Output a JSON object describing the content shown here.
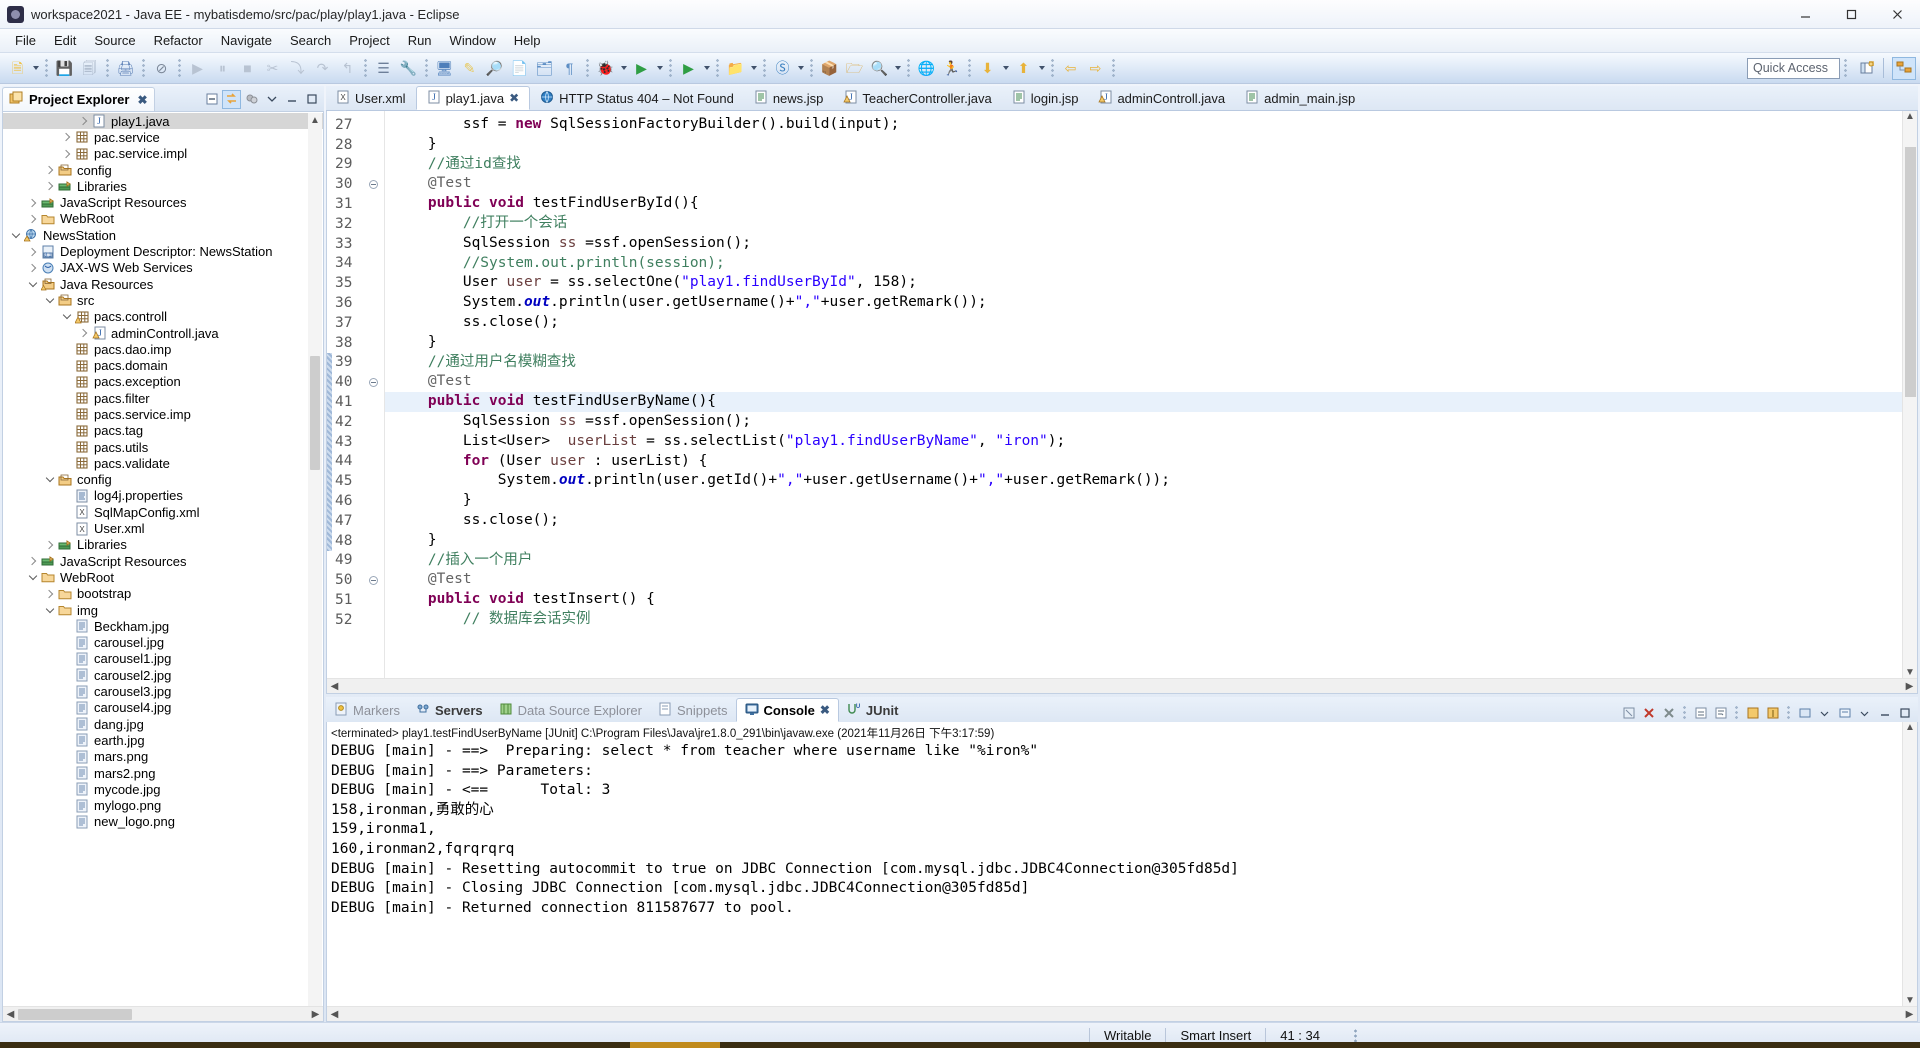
{
  "window": {
    "title": "workspace2021 - Java EE - mybatisdemo/src/pac/play/play1.java - Eclipse",
    "app_icon": "eclipse-icon",
    "minimize": "–",
    "maximize": "□",
    "close": "✕"
  },
  "menubar": {
    "items": [
      "File",
      "Edit",
      "Source",
      "Refactor",
      "Navigate",
      "Search",
      "Project",
      "Run",
      "Window",
      "Help"
    ]
  },
  "toolbar": {
    "quick_access_label": "Quick Access",
    "groups": [
      {
        "name": "new",
        "icons": [
          {
            "n": "new-wizard-icon",
            "g": "🗎",
            "c": "#f0c040"
          },
          {
            "n": "dropdown-arrow",
            "g": "",
            "c": ""
          }
        ]
      },
      {
        "name": "save",
        "icons": [
          {
            "n": "save-icon",
            "g": "💾",
            "c": "#9aa8bb"
          },
          {
            "n": "save-all-icon",
            "g": "🗐",
            "c": "#9aa8bb"
          }
        ]
      },
      {
        "name": "print",
        "icons": [
          {
            "n": "print-icon",
            "g": "🖨",
            "c": "#5b7fb5"
          }
        ]
      },
      {
        "name": "remove-markers",
        "icons": [
          {
            "n": "remove-markers-icon",
            "g": "⊘",
            "c": "#7b8798"
          }
        ]
      },
      {
        "name": "debug-run",
        "icons": [
          {
            "n": "resume-icon",
            "g": "▶",
            "c": "#b8c3d2"
          },
          {
            "n": "suspend-icon",
            "g": "⏸",
            "c": "#b8c3d2"
          },
          {
            "n": "terminate-icon",
            "g": "■",
            "c": "#b8c3d2"
          },
          {
            "n": "disconnect-icon",
            "g": "✂",
            "c": "#b8c3d2"
          },
          {
            "n": "step-into-icon",
            "g": "⤵",
            "c": "#b8c3d2"
          },
          {
            "n": "step-over-icon",
            "g": "↷",
            "c": "#b8c3d2"
          },
          {
            "n": "step-return-icon",
            "g": "↰",
            "c": "#b8c3d2"
          }
        ]
      },
      {
        "name": "build",
        "icons": [
          {
            "n": "build-icon",
            "g": "☰",
            "c": "#6d7f99"
          },
          {
            "n": "run-ant-icon",
            "g": "🔧",
            "c": "#e8b33a"
          }
        ]
      },
      {
        "name": "server",
        "icons": [
          {
            "n": "new-server-icon",
            "g": "🖥",
            "c": "#4f7fba"
          },
          {
            "n": "open-editor-icon",
            "g": "✎",
            "c": "#e8c85a"
          },
          {
            "n": "toggle-mark-icon",
            "g": "🔎",
            "c": "#8a99ad"
          },
          {
            "n": "new-jsp-icon",
            "g": "📄",
            "c": "#5d8ec4"
          },
          {
            "n": "new-xml-icon",
            "g": "🗂",
            "c": "#5d8ec4"
          },
          {
            "n": "new-html-icon",
            "g": "¶",
            "c": "#5d8ec4"
          }
        ]
      },
      {
        "name": "debug-launch",
        "icons": [
          {
            "n": "debug-icon",
            "g": "🐞",
            "c": "#3a7fbf"
          },
          {
            "n": "dropdown-arrow",
            "g": "",
            "c": ""
          },
          {
            "n": "run-icon",
            "g": "▶",
            "c": "#2f9e44"
          },
          {
            "n": "dropdown-arrow",
            "g": "",
            "c": ""
          }
        ]
      },
      {
        "name": "coverage",
        "icons": [
          {
            "n": "coverage-icon",
            "g": "▶",
            "c": "#2f9e44"
          },
          {
            "n": "dropdown-arrow",
            "g": "",
            "c": ""
          }
        ]
      },
      {
        "name": "profile",
        "icons": [
          {
            "n": "new-java-project-icon",
            "g": "📁",
            "c": "#d9a33a"
          },
          {
            "n": "dropdown-arrow",
            "g": "",
            "c": ""
          }
        ]
      },
      {
        "name": "skip",
        "icons": [
          {
            "n": "skip-breakpoints-icon",
            "g": "Ⓢ",
            "c": "#3a7fbf"
          },
          {
            "n": "dropdown-arrow",
            "g": "",
            "c": ""
          }
        ]
      },
      {
        "name": "packages",
        "icons": [
          {
            "n": "new-package-icon",
            "g": "📦",
            "c": "#d9a33a"
          },
          {
            "n": "open-type-icon",
            "g": "🗁",
            "c": "#d9a33a"
          },
          {
            "n": "search-icon",
            "g": "🔍",
            "c": "#d9a33a"
          },
          {
            "n": "dropdown-arrow",
            "g": "",
            "c": ""
          }
        ]
      },
      {
        "name": "web",
        "icons": [
          {
            "n": "open-browser-icon",
            "g": "🌐",
            "c": "#2f7fc4"
          },
          {
            "n": "run-on-server-icon",
            "g": "🏃",
            "c": "#4f8fd0"
          }
        ]
      },
      {
        "name": "navigate",
        "icons": [
          {
            "n": "next-annotation-icon",
            "g": "⬇",
            "c": "#e8b33a"
          },
          {
            "n": "dropdown-arrow",
            "g": "",
            "c": ""
          },
          {
            "n": "previous-annotation-icon",
            "g": "⬆",
            "c": "#e8b33a"
          },
          {
            "n": "dropdown-arrow",
            "g": "",
            "c": ""
          }
        ]
      },
      {
        "name": "history",
        "icons": [
          {
            "n": "back-icon",
            "g": "⇦",
            "c": "#e8b33a"
          },
          {
            "n": "forward-icon",
            "g": "⇨",
            "c": "#e8b33a"
          }
        ]
      }
    ],
    "perspective_buttons": [
      {
        "name": "open-perspective-button",
        "icon": "new-perspective-icon"
      },
      {
        "name": "java-ee-perspective-button",
        "icon": "java-ee-perspective-icon",
        "active": true
      }
    ]
  },
  "explorer": {
    "tab_label": "Project Explorer",
    "tab_icon": "project-explorer-icon",
    "close_icon": "✖",
    "toolbar": [
      {
        "name": "collapse-all-button",
        "icon": "collapse-all-icon"
      },
      {
        "name": "link-with-editor-button",
        "icon": "link-editor-icon",
        "active": true
      },
      {
        "name": "focus-on-active-task-button",
        "icon": "focus-task-icon"
      },
      {
        "name": "view-menu-button",
        "icon": "chevron-down-icon"
      },
      {
        "name": "minimize-view-button",
        "icon": "minimize-icon"
      },
      {
        "name": "maximize-view-button",
        "icon": "maximize-icon"
      }
    ],
    "tree": [
      {
        "label": "play1.java",
        "indent": 4,
        "twist": "closed",
        "icon": "java-file-icon",
        "selected": true
      },
      {
        "label": "pac.service",
        "indent": 3,
        "twist": "closed",
        "icon": "package-icon"
      },
      {
        "label": "pac.service.impl",
        "indent": 3,
        "twist": "closed",
        "icon": "package-icon"
      },
      {
        "label": "config",
        "indent": 2,
        "twist": "closed",
        "icon": "source-folder-icon"
      },
      {
        "label": "Libraries",
        "indent": 2,
        "twist": "closed",
        "icon": "library-icon"
      },
      {
        "label": "JavaScript Resources",
        "indent": 1,
        "twist": "closed",
        "icon": "library-icon"
      },
      {
        "label": "WebRoot",
        "indent": 1,
        "twist": "closed",
        "icon": "folder-icon"
      },
      {
        "label": "NewsStation",
        "indent": 0,
        "twist": "open",
        "icon": "web-project-icon"
      },
      {
        "label": "Deployment Descriptor: NewsStation",
        "indent": 1,
        "twist": "closed",
        "icon": "deployment-descriptor-icon"
      },
      {
        "label": "JAX-WS Web Services",
        "indent": 1,
        "twist": "closed",
        "icon": "jaxws-icon"
      },
      {
        "label": "Java Resources",
        "indent": 1,
        "twist": "open",
        "icon": "java-resources-icon"
      },
      {
        "label": "src",
        "indent": 2,
        "twist": "open",
        "icon": "source-folder-icon"
      },
      {
        "label": "pacs.controll",
        "indent": 3,
        "twist": "open",
        "icon": "package-warning-icon"
      },
      {
        "label": "adminControll.java",
        "indent": 4,
        "twist": "closed",
        "icon": "java-warning-icon"
      },
      {
        "label": "pacs.dao.imp",
        "indent": 3,
        "twist": "none",
        "icon": "package-icon"
      },
      {
        "label": "pacs.domain",
        "indent": 3,
        "twist": "none",
        "icon": "package-icon"
      },
      {
        "label": "pacs.exception",
        "indent": 3,
        "twist": "none",
        "icon": "package-icon"
      },
      {
        "label": "pacs.filter",
        "indent": 3,
        "twist": "none",
        "icon": "package-icon"
      },
      {
        "label": "pacs.service.imp",
        "indent": 3,
        "twist": "none",
        "icon": "package-icon"
      },
      {
        "label": "pacs.tag",
        "indent": 3,
        "twist": "none",
        "icon": "package-icon"
      },
      {
        "label": "pacs.utils",
        "indent": 3,
        "twist": "none",
        "icon": "package-icon"
      },
      {
        "label": "pacs.validate",
        "indent": 3,
        "twist": "none",
        "icon": "package-icon"
      },
      {
        "label": "config",
        "indent": 2,
        "twist": "open",
        "icon": "source-folder-icon"
      },
      {
        "label": "log4j.properties",
        "indent": 3,
        "twist": "none",
        "icon": "properties-file-icon"
      },
      {
        "label": "SqlMapConfig.xml",
        "indent": 3,
        "twist": "none",
        "icon": "xml-file-icon"
      },
      {
        "label": "User.xml",
        "indent": 3,
        "twist": "none",
        "icon": "xml-file-icon"
      },
      {
        "label": "Libraries",
        "indent": 2,
        "twist": "closed",
        "icon": "library-icon"
      },
      {
        "label": "JavaScript Resources",
        "indent": 1,
        "twist": "closed",
        "icon": "library-icon"
      },
      {
        "label": "WebRoot",
        "indent": 1,
        "twist": "open",
        "icon": "folder-icon"
      },
      {
        "label": "bootstrap",
        "indent": 2,
        "twist": "closed",
        "icon": "folder-icon"
      },
      {
        "label": "img",
        "indent": 2,
        "twist": "open",
        "icon": "folder-icon"
      },
      {
        "label": "Beckham.jpg",
        "indent": 3,
        "twist": "none",
        "icon": "file-icon"
      },
      {
        "label": "carousel.jpg",
        "indent": 3,
        "twist": "none",
        "icon": "file-icon"
      },
      {
        "label": "carousel1.jpg",
        "indent": 3,
        "twist": "none",
        "icon": "file-icon"
      },
      {
        "label": "carousel2.jpg",
        "indent": 3,
        "twist": "none",
        "icon": "file-icon"
      },
      {
        "label": "carousel3.jpg",
        "indent": 3,
        "twist": "none",
        "icon": "file-icon"
      },
      {
        "label": "carousel4.jpg",
        "indent": 3,
        "twist": "none",
        "icon": "file-icon"
      },
      {
        "label": "dang.jpg",
        "indent": 3,
        "twist": "none",
        "icon": "file-icon"
      },
      {
        "label": "earth.jpg",
        "indent": 3,
        "twist": "none",
        "icon": "file-icon"
      },
      {
        "label": "mars.png",
        "indent": 3,
        "twist": "none",
        "icon": "file-icon"
      },
      {
        "label": "mars2.png",
        "indent": 3,
        "twist": "none",
        "icon": "file-icon"
      },
      {
        "label": "mycode.jpg",
        "indent": 3,
        "twist": "none",
        "icon": "file-icon"
      },
      {
        "label": "mylogo.png",
        "indent": 3,
        "twist": "none",
        "icon": "file-icon"
      },
      {
        "label": "new_logo.png",
        "indent": 3,
        "twist": "none",
        "icon": "file-icon"
      }
    ]
  },
  "editor": {
    "tabs": [
      {
        "label": "User.xml",
        "icon": "xml-file-icon",
        "active": false
      },
      {
        "label": "play1.java",
        "icon": "java-file-icon",
        "active": true,
        "closeable": true
      },
      {
        "label": "HTTP Status 404 – Not Found",
        "icon": "browser-icon",
        "active": false
      },
      {
        "label": "news.jsp",
        "icon": "jsp-file-icon",
        "active": false
      },
      {
        "label": "TeacherController.java",
        "icon": "java-warning-icon",
        "active": false
      },
      {
        "label": "login.jsp",
        "icon": "jsp-file-icon",
        "active": false
      },
      {
        "label": "adminControll.java",
        "icon": "java-warning-icon",
        "active": false
      },
      {
        "label": "admin_main.jsp",
        "icon": "jsp-file-icon",
        "active": false
      }
    ],
    "first_line": 27,
    "lines": [
      {
        "n": 27,
        "html": "        ssf = <span class=\"kw\">new</span> SqlSessionFactoryBuilder().build(input);"
      },
      {
        "n": 28,
        "html": "    }"
      },
      {
        "n": 29,
        "html": "    <span class=\"cm\">//通过id查找</span>"
      },
      {
        "n": 30,
        "html": "    <span class=\"an\">@Test</span>",
        "fold": true
      },
      {
        "n": 31,
        "html": "    <span class=\"kw\">public</span> <span class=\"kw\">void</span> testFindUserById(){"
      },
      {
        "n": 32,
        "html": "        <span class=\"cm\">//打开一个会话</span>"
      },
      {
        "n": 33,
        "html": "        SqlSession <span class=\"lv\">ss</span> =ssf.openSession();"
      },
      {
        "n": 34,
        "html": "        <span class=\"cm\">//System.out.println(session);</span>"
      },
      {
        "n": 35,
        "html": "        User <span class=\"lv\">user</span> = ss.selectOne(<span class=\"st\">\"play1.findUserById\"</span>, 158);"
      },
      {
        "n": 36,
        "html": "        System.<span class=\"fld\">out</span>.println(user.getUsername()+<span class=\"st\">\",\"</span>+user.getRemark());"
      },
      {
        "n": 37,
        "html": "        ss.close();"
      },
      {
        "n": 38,
        "html": "    }"
      },
      {
        "n": 39,
        "html": "    <span class=\"cm\">//通过用户名模糊查找</span>",
        "change": true
      },
      {
        "n": 40,
        "html": "    <span class=\"an\">@Test</span>",
        "fold": true,
        "change": true
      },
      {
        "n": 41,
        "html": "    <span class=\"kw\">public</span> <span class=\"kw\">void</span> testFindUserByName(){",
        "highlight": true,
        "change": true
      },
      {
        "n": 42,
        "html": "        SqlSession <span class=\"lv\">ss</span> =ssf.openSession();",
        "change": true
      },
      {
        "n": 43,
        "html": "        List&lt;User&gt;  <span class=\"lv\">userList</span> = ss.selectList(<span class=\"st\">\"play1.findUserByName\"</span>, <span class=\"st\">\"iron\"</span>);",
        "change": true
      },
      {
        "n": 44,
        "html": "        <span class=\"kw\">for</span> (User <span class=\"lv\">user</span> : userList) {",
        "change": true
      },
      {
        "n": 45,
        "html": "            System.<span class=\"fld\">out</span>.println(user.getId()+<span class=\"st\">\",\"</span>+user.getUsername()+<span class=\"st\">\",\"</span>+user.getRemark());",
        "change": true
      },
      {
        "n": 46,
        "html": "        }",
        "change": true
      },
      {
        "n": 47,
        "html": "        ss.close();",
        "change": true
      },
      {
        "n": 48,
        "html": "    }",
        "change": true
      },
      {
        "n": 49,
        "html": "    <span class=\"cm\">//插入一个用户</span>"
      },
      {
        "n": 50,
        "html": "    <span class=\"an\">@Test</span>",
        "fold": true
      },
      {
        "n": 51,
        "html": "    <span class=\"kw\">public</span> <span class=\"kw\">void</span> testInsert() {"
      },
      {
        "n": 52,
        "html": "        <span class=\"cm\">// 数据库会话实例</span>"
      }
    ]
  },
  "console": {
    "tabs": [
      {
        "label": "Markers",
        "icon": "markers-icon",
        "active": false,
        "bold": false
      },
      {
        "label": "Servers",
        "icon": "servers-icon",
        "active": false,
        "bold": true
      },
      {
        "label": "Data Source Explorer",
        "icon": "data-source-icon",
        "active": false,
        "bold": false
      },
      {
        "label": "Snippets",
        "icon": "snippets-icon",
        "active": false,
        "bold": false
      },
      {
        "label": "Console",
        "icon": "console-icon",
        "active": true,
        "bold": true,
        "closeable": true
      },
      {
        "label": "JUnit",
        "icon": "junit-icon",
        "active": false,
        "bold": true
      }
    ],
    "toolbar": [
      {
        "name": "clear-console-button",
        "icon": "clear-console-icon"
      },
      {
        "name": "terminate-button",
        "icon": "terminate-icon"
      },
      {
        "name": "remove-launch-button",
        "icon": "remove-launch-icon"
      },
      {
        "name": "remove-all-terminated-button",
        "icon": "remove-all-icon"
      },
      {
        "name": "scroll-lock-button",
        "icon": "scroll-lock-icon"
      },
      {
        "name": "word-wrap-button",
        "icon": "word-wrap-icon"
      },
      {
        "name": "show-console-on-output-button",
        "icon": "show-console-icon"
      },
      {
        "name": "pin-console-button",
        "icon": "pin-icon"
      },
      {
        "name": "open-console-button",
        "icon": "open-console-icon"
      },
      {
        "name": "display-selected-console-button",
        "icon": "display-console-icon"
      },
      {
        "name": "view-menu-button",
        "icon": "chevron-down-icon"
      },
      {
        "name": "minimize-panel-button",
        "icon": "minimize-icon"
      },
      {
        "name": "maximize-panel-button",
        "icon": "maximize-icon"
      }
    ],
    "header": "<terminated> play1.testFindUserByName [JUnit] C:\\Program Files\\Java\\jre1.8.0_291\\bin\\javaw.exe (2021年11月26日 下午3:17:59)",
    "lines": [
      "DEBUG [main] - ==>  Preparing: select * from teacher where username like \"%iron%\"",
      "DEBUG [main] - ==> Parameters:",
      "DEBUG [main] - <==      Total: 3",
      "158,ironman,勇敢的心",
      "159,ironma1,",
      "160,ironman2,fqrqrqrq",
      "DEBUG [main] - Resetting autocommit to true on JDBC Connection [com.mysql.jdbc.JDBC4Connection@305fd85d]",
      "DEBUG [main] - Closing JDBC Connection [com.mysql.jdbc.JDBC4Connection@305fd85d]",
      "DEBUG [main] - Returned connection 811587677 to pool."
    ]
  },
  "statusbar": {
    "writable": "Writable",
    "insert_mode": "Smart Insert",
    "cursor_position": "41 : 34"
  }
}
